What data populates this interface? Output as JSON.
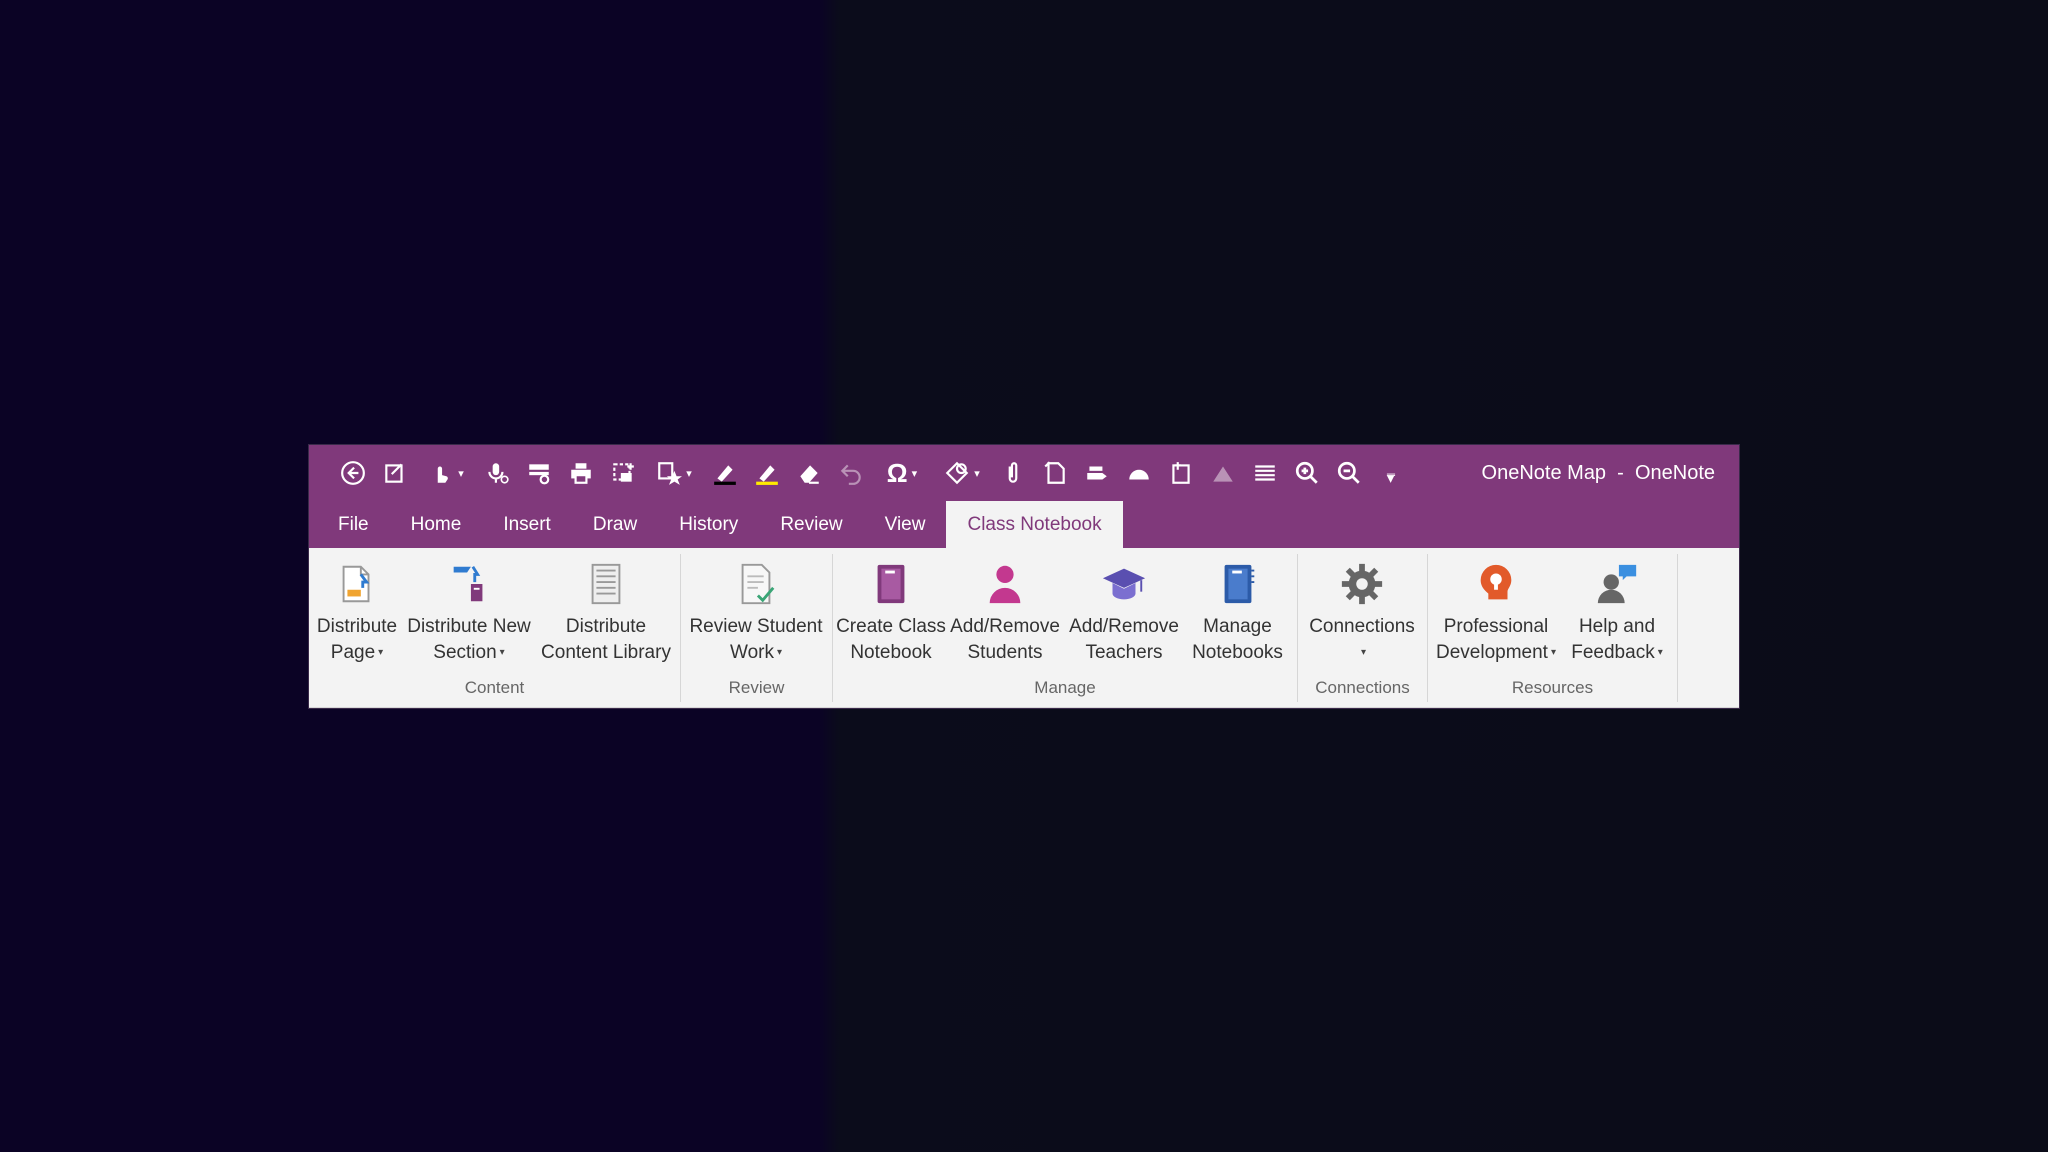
{
  "window": {
    "title": "OneNote Map  -  OneNote"
  },
  "qat": [
    {
      "name": "back-icon"
    },
    {
      "name": "new-page-icon"
    },
    {
      "name": "touch-mode-icon"
    },
    {
      "name": "dictate-icon"
    },
    {
      "name": "dock-to-desktop-icon"
    },
    {
      "name": "print-icon"
    },
    {
      "name": "screen-clipping-icon"
    },
    {
      "name": "tag-icon"
    },
    {
      "name": "pen-icon"
    },
    {
      "name": "highlighter-icon"
    },
    {
      "name": "eraser-icon"
    },
    {
      "name": "undo-icon"
    },
    {
      "name": "symbol-icon"
    },
    {
      "name": "shapes-icon"
    },
    {
      "name": "attach-file-icon"
    },
    {
      "name": "page-template-icon"
    },
    {
      "name": "lasso-icon"
    },
    {
      "name": "panning-hand-icon"
    },
    {
      "name": "side-note-icon"
    },
    {
      "name": "ink-to-math-icon"
    },
    {
      "name": "align-icon"
    },
    {
      "name": "zoom-in-icon"
    },
    {
      "name": "zoom-out-icon"
    },
    {
      "name": "customize-qat-icon"
    }
  ],
  "tabs": {
    "file": "File",
    "home": "Home",
    "insert": "Insert",
    "draw": "Draw",
    "history": "History",
    "review": "Review",
    "view": "View",
    "class_notebook": "Class Notebook"
  },
  "ribbon": {
    "content": {
      "label": "Content",
      "distribute_page": [
        "Distribute",
        "Page"
      ],
      "distribute_new_section": [
        "Distribute New",
        "Section"
      ],
      "distribute_content_library": [
        "Distribute",
        "Content Library"
      ]
    },
    "review": {
      "label": "Review",
      "review_student_work": [
        "Review Student",
        "Work"
      ]
    },
    "manage": {
      "label": "Manage",
      "create_class_notebook": [
        "Create Class",
        "Notebook"
      ],
      "add_remove_students": [
        "Add/Remove",
        "Students"
      ],
      "add_remove_teachers": [
        "Add/Remove",
        "Teachers"
      ],
      "manage_notebooks": [
        "Manage",
        "Notebooks"
      ]
    },
    "connections": {
      "label": "Connections",
      "connections": [
        "Connections"
      ]
    },
    "resources": {
      "label": "Resources",
      "professional_development": [
        "Professional",
        "Development"
      ],
      "help_and_feedback": [
        "Help and",
        "Feedback"
      ]
    }
  },
  "colors": {
    "accent": "#80397b",
    "ribbon_bg": "#f3f3f3",
    "background": "#0b0325"
  }
}
